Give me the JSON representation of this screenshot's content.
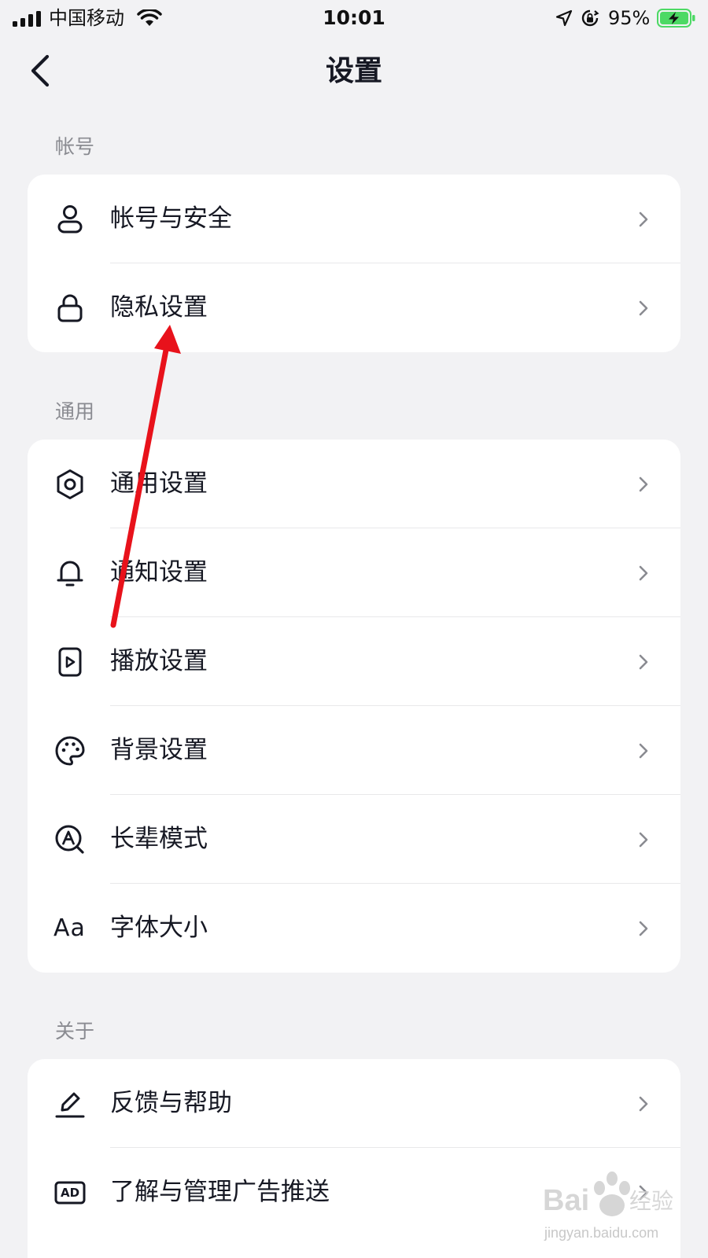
{
  "status_bar": {
    "carrier": "中国移动",
    "time": "10:01",
    "battery_percent": "95%",
    "signal_icon": "signal-bars-icon",
    "wifi_icon": "wifi-icon",
    "location_icon": "location-arrow-icon",
    "orientation_lock_icon": "orientation-lock-icon",
    "battery_icon": "battery-charging-icon",
    "battery_color": "#4cd964"
  },
  "nav": {
    "title": "设置",
    "back_icon": "chevron-left-icon"
  },
  "sections": [
    {
      "header": "帐号",
      "items": [
        {
          "label": "帐号与安全",
          "icon": "person-icon"
        },
        {
          "label": "隐私设置",
          "icon": "lock-icon"
        }
      ]
    },
    {
      "header": "通用",
      "items": [
        {
          "label": "通用设置",
          "icon": "gear-icon"
        },
        {
          "label": "通知设置",
          "icon": "bell-icon"
        },
        {
          "label": "播放设置",
          "icon": "play-icon"
        },
        {
          "label": "背景设置",
          "icon": "palette-icon"
        },
        {
          "label": "长辈模式",
          "icon": "magnifier-a-icon"
        },
        {
          "label": "字体大小",
          "icon": "font-size-icon",
          "icon_text": "Aa"
        }
      ]
    },
    {
      "header": "关于",
      "items": [
        {
          "label": "反馈与帮助",
          "icon": "pencil-icon"
        },
        {
          "label": "了解与管理广告推送",
          "icon": "ad-icon",
          "icon_text": "AD"
        }
      ]
    }
  ],
  "annotation": {
    "arrow_icon": "red-arrow-icon",
    "arrow_color": "#e8121b"
  },
  "watermark": {
    "logo_text": "Bai 经验",
    "url_text": "jingyan.baidu.com"
  }
}
